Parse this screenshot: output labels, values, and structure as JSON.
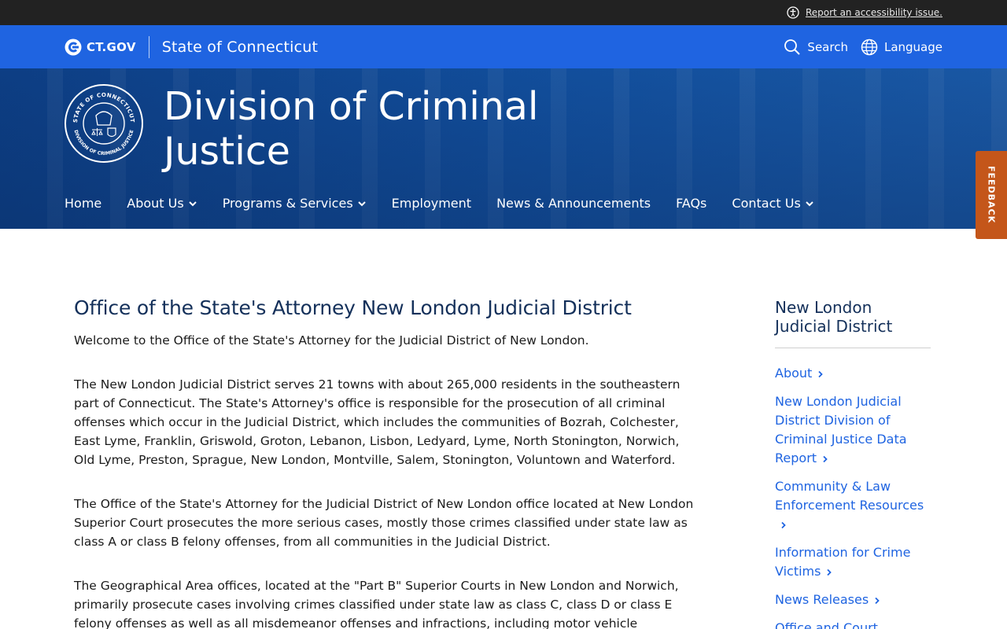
{
  "utility": {
    "accessibility_link": "Report an accessibility issue."
  },
  "gov_bar": {
    "logo_text": "CT.GOV",
    "state_name": "State of Connecticut",
    "search_label": "Search",
    "language_label": "Language"
  },
  "hero": {
    "seal_text_top": "STATE OF CONNECTICUT",
    "seal_text_bottom": "DIVISION OF CRIMINAL JUSTICE",
    "title": "Division of Criminal Justice"
  },
  "nav": {
    "items": [
      {
        "label": "Home",
        "dropdown": false
      },
      {
        "label": "About Us",
        "dropdown": true
      },
      {
        "label": "Programs & Services",
        "dropdown": true
      },
      {
        "label": "Employment",
        "dropdown": false
      },
      {
        "label": "News & Announcements",
        "dropdown": false
      },
      {
        "label": "FAQs",
        "dropdown": false
      },
      {
        "label": "Contact Us",
        "dropdown": true
      }
    ]
  },
  "feedback": {
    "label": "FEEDBACK"
  },
  "article": {
    "heading": "Office of the State's Attorney New London Judicial District",
    "paragraphs": [
      "Welcome to the Office of the State's Attorney for the Judicial District of New London.",
      "The New London Judicial District serves 21 towns with about 265,000 residents in the southeastern part of Connecticut. The State's Attorney's office is responsible for the prosecution of all criminal offenses which occur in the Judicial District, which includes the communities of Bozrah, Colchester, East Lyme, Franklin, Griswold, Groton, Lebanon, Lisbon, Ledyard, Lyme, North Stonington, Norwich, Old Lyme, Preston, Sprague, New London, Montville, Salem, Stonington, Voluntown and Waterford.",
      "The Office of the State's Attorney for the Judicial District of New London office located at New London Superior Court prosecutes the more serious cases, mostly those crimes classified under state law as class A or class B felony offenses, from all communities in the Judicial District.",
      "The Geographical Area offices, located at the \"Part B\" Superior Courts in New London and Norwich, primarily prosecute cases involving crimes classified under state law as class C, class D or class E felony offenses as well as all misdemeanor offenses and infractions, including motor vehicle"
    ]
  },
  "sidebar": {
    "heading": "New London Judicial District",
    "links": [
      "About",
      "New London Judicial District Division of Criminal Justice Data Report",
      "Community & Law Enforcement Resources",
      "Information for Crime Victims",
      "News Releases",
      "Office and Court"
    ]
  },
  "colors": {
    "gov_blue": "#1f64e1",
    "hero_blue": "#12509f",
    "feedback_orange": "#c4561a",
    "heading_navy": "#14305a"
  }
}
